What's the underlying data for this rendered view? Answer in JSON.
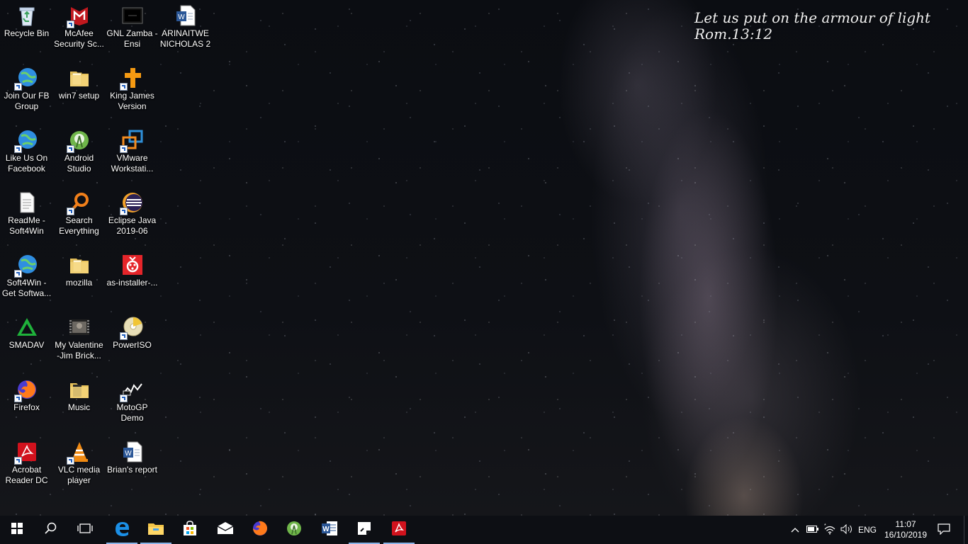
{
  "wallpaper": {
    "verse_line1": "Let us put on the armour of light",
    "verse_line2": "Rom.13:12"
  },
  "desktop": {
    "icons": [
      {
        "label": "Recycle Bin",
        "icon": "recycle-bin-icon"
      },
      {
        "label": "McAfee Security Sc...",
        "icon": "mcafee-icon"
      },
      {
        "label": "GNL Zamba - Ensi",
        "icon": "video-file-icon"
      },
      {
        "label": "ARINAITWE NICHOLAS 2",
        "icon": "word-document-icon"
      },
      {
        "label": "Join Our FB Group",
        "icon": "internet-shortcut-icon"
      },
      {
        "label": "win7 setup",
        "icon": "folder-icon"
      },
      {
        "label": "King James Version",
        "icon": "cross-icon"
      },
      {
        "label": "Like Us On Facebook",
        "icon": "internet-shortcut-icon"
      },
      {
        "label": "Android Studio",
        "icon": "android-studio-icon"
      },
      {
        "label": "VMware Workstati...",
        "icon": "vmware-icon"
      },
      {
        "label": "ReadMe - Soft4Win",
        "icon": "text-file-icon"
      },
      {
        "label": "Search Everything",
        "icon": "search-everything-icon"
      },
      {
        "label": "Eclipse Java 2019-06",
        "icon": "eclipse-icon"
      },
      {
        "label": "Soft4Win - Get Softwa...",
        "icon": "internet-shortcut-icon"
      },
      {
        "label": "mozilla",
        "icon": "folder-icon"
      },
      {
        "label": "as-installer-...",
        "icon": "installer-icon"
      },
      {
        "label": "SMADAV",
        "icon": "smadav-icon"
      },
      {
        "label": "My Valentine -Jim Brick...",
        "icon": "video-file-icon"
      },
      {
        "label": "PowerISO",
        "icon": "poweriso-icon"
      },
      {
        "label": "Firefox",
        "icon": "firefox-icon"
      },
      {
        "label": "Music",
        "icon": "folder-icon"
      },
      {
        "label": "MotoGP Demo",
        "icon": "game-icon"
      },
      {
        "label": "Acrobat Reader DC",
        "icon": "acrobat-icon"
      },
      {
        "label": "VLC media player",
        "icon": "vlc-icon"
      },
      {
        "label": "Brian's report",
        "icon": "word-document-icon"
      }
    ]
  },
  "taskbar": {
    "pinned": [
      {
        "name": "start-button",
        "icon": "windows-logo-icon"
      },
      {
        "name": "search-button",
        "icon": "search-icon"
      },
      {
        "name": "task-view-button",
        "icon": "task-view-icon"
      },
      {
        "name": "edge-button",
        "icon": "edge-icon"
      },
      {
        "name": "file-explorer-button",
        "icon": "folder-icon"
      },
      {
        "name": "store-button",
        "icon": "store-icon"
      },
      {
        "name": "mail-button",
        "icon": "mail-icon"
      },
      {
        "name": "firefox-button",
        "icon": "firefox-icon"
      },
      {
        "name": "android-studio-button",
        "icon": "android-studio-icon"
      },
      {
        "name": "word-button",
        "icon": "word-icon"
      },
      {
        "name": "sticky-notes-button",
        "icon": "sticky-notes-icon"
      },
      {
        "name": "acrobat-button",
        "icon": "acrobat-icon"
      }
    ],
    "tray": {
      "language": "ENG",
      "time": "11:07",
      "date": "16/10/2019"
    }
  }
}
